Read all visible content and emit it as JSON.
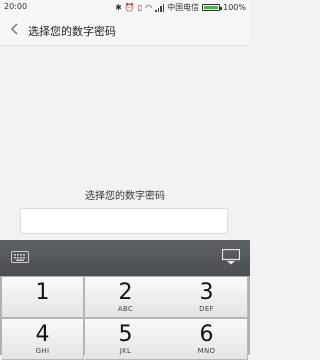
{
  "status_bar": {
    "time": "20:00",
    "icons": [
      "bluetooth-icon",
      "alarm-icon",
      "vibrate-icon",
      "wifi-icon",
      "signal-icon"
    ],
    "carrier": "中国电信",
    "battery": {
      "percent_label": "100%",
      "level": 1.0,
      "color": "#3fbf3f"
    }
  },
  "header": {
    "title": "选择您的数字密码",
    "back_icon": "chevron-left-icon"
  },
  "main": {
    "prompt": "选择您的数字密码",
    "pin_value": ""
  },
  "keyboard_toolbar": {
    "left_icon": "keyboard-icon",
    "right_icon": "hide-keyboard-icon"
  },
  "keypad": {
    "keys": [
      {
        "digit": "1",
        "letters": ""
      },
      {
        "digit": "2",
        "letters": "ABC"
      },
      {
        "digit": "3",
        "letters": "DEF"
      },
      {
        "digit": "4",
        "letters": "GHI"
      },
      {
        "digit": "5",
        "letters": "JKL"
      },
      {
        "digit": "6",
        "letters": "MNO"
      }
    ]
  }
}
